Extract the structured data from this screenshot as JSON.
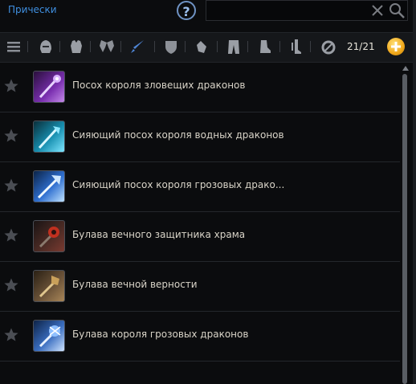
{
  "header": {
    "title": "Прически",
    "help_symbol": "?",
    "search": {
      "value": "",
      "placeholder": ""
    }
  },
  "filters": {
    "icons": [
      "list-icon",
      "helmet-icon",
      "armor-icon",
      "wings-icon",
      "sword-icon",
      "shield-icon",
      "gauntlet-icon",
      "pants-icon",
      "boots-icon",
      "leg-icon",
      "ring-icon"
    ],
    "count": "21/21"
  },
  "items": [
    {
      "name": "Посох короля зловещих драконов",
      "icon": "purple-staff-icon",
      "favorite": false
    },
    {
      "name": "Сияющий посох короля водных драконов",
      "icon": "water-staff-icon",
      "favorite": false
    },
    {
      "name": "Сияющий посох короля грозовых драко...",
      "icon": "storm-staff-icon",
      "favorite": false
    },
    {
      "name": "Булава вечного защитника храма",
      "icon": "temple-mace-icon",
      "favorite": false
    },
    {
      "name": "Булава вечной верности",
      "icon": "fidelity-mace-icon",
      "favorite": false
    },
    {
      "name": "Булава короля грозовых драконов",
      "icon": "storm-mace-icon",
      "favorite": false
    }
  ],
  "colors": {
    "accent": "#3f8fe0",
    "background": "#0b0c0e",
    "gold": "#f0a71a"
  }
}
